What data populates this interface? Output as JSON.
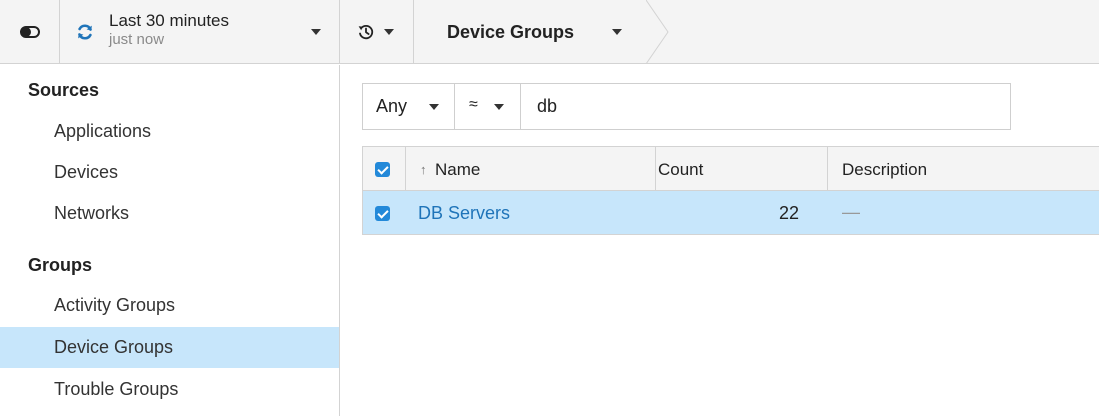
{
  "topbar": {
    "time_range": {
      "title": "Last 30 minutes",
      "subtitle": "just now"
    },
    "breadcrumb": {
      "label": "Device Groups"
    }
  },
  "sidebar": {
    "sections": [
      {
        "heading": "Sources",
        "items": [
          "Applications",
          "Devices",
          "Networks"
        ]
      },
      {
        "heading": "Groups",
        "items": [
          "Activity Groups",
          "Device Groups",
          "Trouble Groups"
        ]
      }
    ],
    "active_item": "Device Groups"
  },
  "filter": {
    "match": "Any",
    "operator": "≈",
    "value": "db"
  },
  "table": {
    "columns": [
      "Name",
      "Count",
      "Description"
    ],
    "sort_indicator": "↑",
    "rows": [
      {
        "name": "DB Servers",
        "count": "22",
        "description": "—",
        "selected": true
      }
    ]
  },
  "colors": {
    "accent": "#2389d9",
    "link": "#1f74b9",
    "selection": "#c7e6fb",
    "bar": "#f4f4f4",
    "border": "#d3d3d3"
  },
  "icons": {
    "toggle": "sidebar-toggle-icon",
    "refresh": "refresh-icon",
    "history": "history-icon",
    "dropdown": "caret-down-icon",
    "sort": "sort-ascending-icon",
    "checkbox": "checkbox-checked-icon"
  }
}
